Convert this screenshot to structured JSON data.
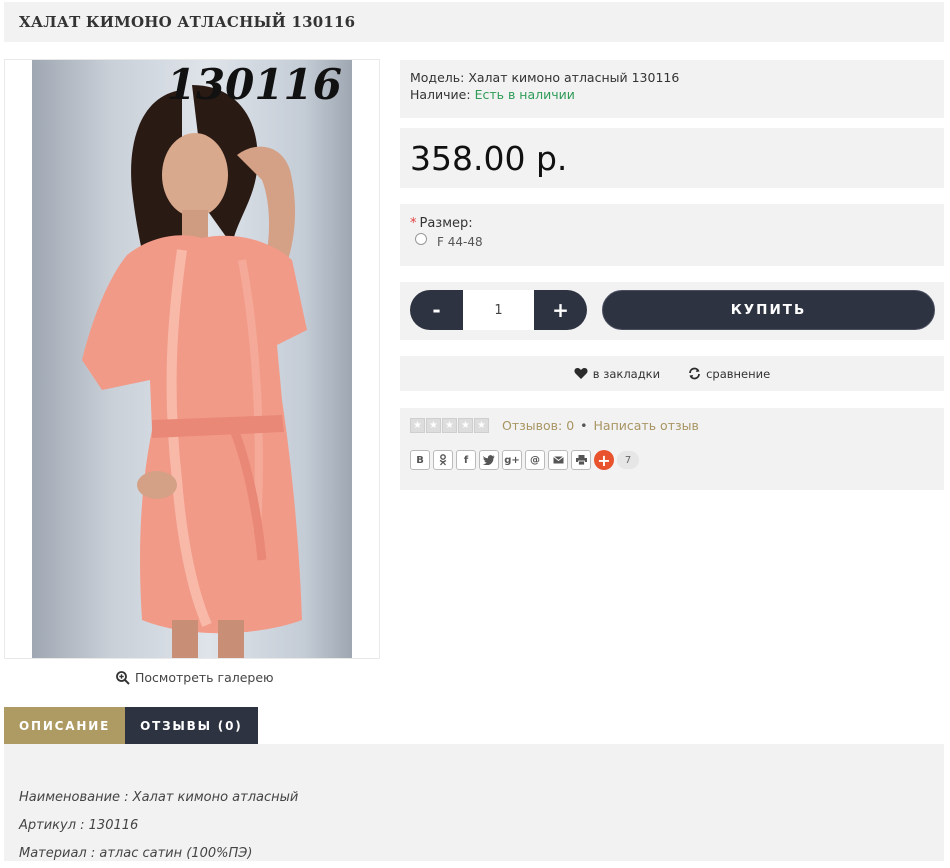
{
  "product": {
    "title": "ХАЛАТ КИМОНО АТЛАСНЫЙ 130116",
    "photo_code": "130116",
    "gallery_link": "Посмотреть галерею"
  },
  "meta": {
    "model_label": "Модель:",
    "model_value": "Халат кимоно атласный 130116",
    "stock_label": "Наличие:",
    "stock_value": "Есть в наличии"
  },
  "price": "358.00 р.",
  "option": {
    "required_mark": "*",
    "label": "Размер:",
    "choices": [
      "F 44-48"
    ]
  },
  "buy": {
    "minus": "-",
    "plus": "+",
    "quantity": "1",
    "buy_label": "КУПИТЬ"
  },
  "actions": {
    "wishlist": "в закладки",
    "compare": "сравнение"
  },
  "reviews": {
    "rating_stars": 0,
    "reviews_link": "Отзывов: 0",
    "separator": "•",
    "write_link": "Написать отзыв"
  },
  "share": {
    "buttons": [
      "B",
      "ok",
      "f",
      "twitter",
      "g+",
      "@",
      "mail",
      "print"
    ],
    "count": "7"
  },
  "tabs": {
    "description": "ОПИСАНИЕ",
    "reviews": "ОТЗЫВЫ (0)"
  },
  "description": {
    "lines": [
      "Наименование : Халат кимоно атласный",
      "Артикул : 130116",
      "Материал : атлас сатин (100%ПЭ)"
    ]
  },
  "colors": {
    "dark": "#2e3341",
    "accent": "#ad9b63",
    "stock_green": "#2e9b57",
    "panel": "#f2f2f2"
  }
}
